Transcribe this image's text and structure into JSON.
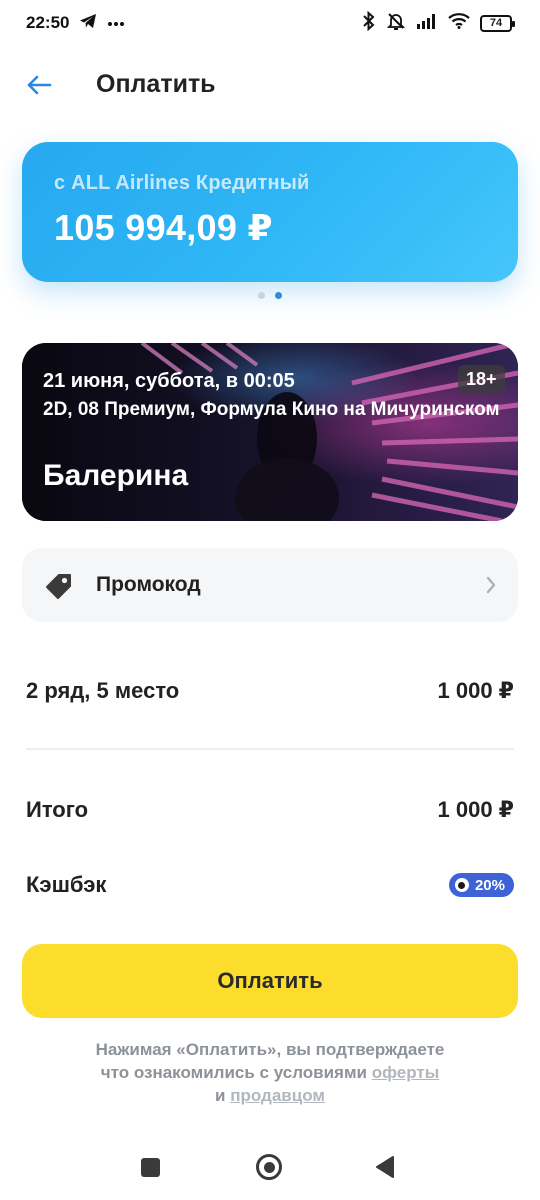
{
  "status_bar": {
    "time": "22:50",
    "battery": "74",
    "icons": [
      "telegram-icon",
      "more-icon",
      "bluetooth-icon",
      "mute-icon",
      "signal-icon",
      "wifi-icon",
      "battery-icon"
    ]
  },
  "header": {
    "title": "Оплатить"
  },
  "card": {
    "label": "с ALL Airlines Кредитный",
    "amount": "105 994,09 ₽",
    "color": "#2fb7f6",
    "carousel_pages": 2,
    "active_page": 2
  },
  "movie": {
    "datetime": "21 июня, суббота, в 00:05",
    "hall": "2D, 08 Премиум, Формула Кино на Мичуринском",
    "title": "Балерина",
    "age_rating": "18+"
  },
  "promo": {
    "label": "Промокод"
  },
  "order": {
    "seat_label": "2 ряд, 5 место",
    "seat_price": "1 000 ₽",
    "total_label": "Итого",
    "total_value": "1 000 ₽",
    "cashback_label": "Кэшбэк",
    "cashback_value": "20%",
    "cashback_color": "#3d63d6"
  },
  "pay_button": {
    "label": "Оплатить",
    "color": "#fddd2c"
  },
  "legal": {
    "line1": "Нажимая «Оплатить», вы подтверждаете",
    "line2_prefix": "что ознакомились с условиями",
    "offer_link": "оферты",
    "and": "и",
    "seller_link": "продавцом"
  }
}
